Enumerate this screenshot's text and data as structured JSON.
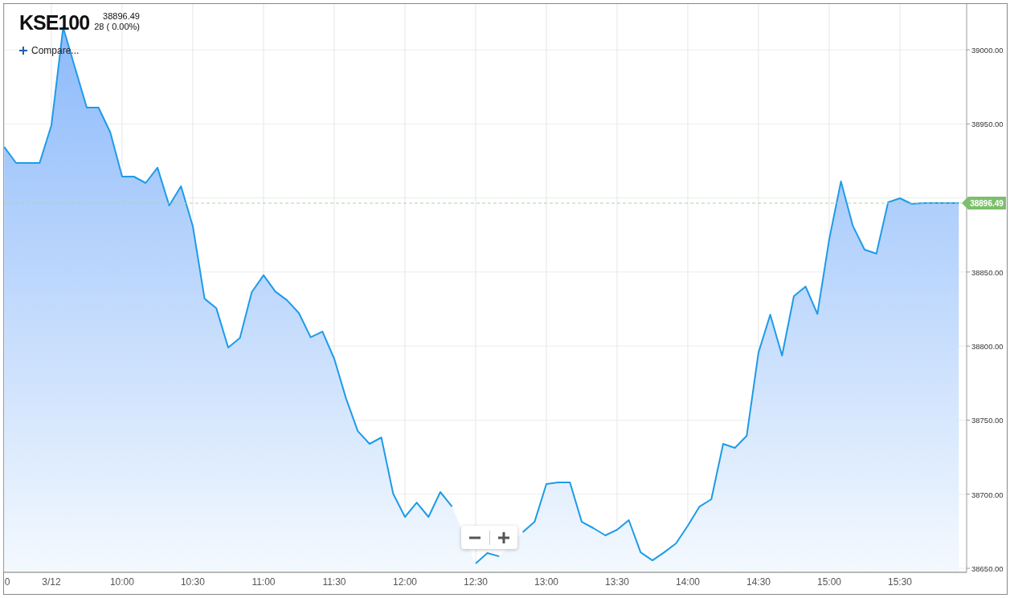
{
  "header": {
    "symbol": "KSE100",
    "price": "38896.49",
    "change": "28 ( 0.00%)",
    "compare_button": "Compare..."
  },
  "price_tag": "38896.49",
  "chart_data": {
    "type": "area",
    "grid": true,
    "ylim": [
      38647.3,
      39030.9
    ],
    "ref_lines": [
      {
        "axis": "y",
        "value": 38896.5,
        "color": "#a9d8a2"
      }
    ],
    "categories": [
      "0",
      null,
      null,
      null,
      "3/12",
      null,
      null,
      null,
      null,
      null,
      "10:00",
      null,
      null,
      null,
      null,
      null,
      "10:30",
      null,
      null,
      null,
      null,
      null,
      "11:00",
      null,
      null,
      null,
      null,
      null,
      "11:30",
      null,
      null,
      null,
      null,
      null,
      "12:00",
      null,
      null,
      null,
      null,
      null,
      "12:30",
      null,
      null,
      null,
      null,
      null,
      "13:00",
      null,
      null,
      null,
      null,
      null,
      "13:30",
      null,
      null,
      null,
      null,
      null,
      "14:00",
      null,
      null,
      null,
      null,
      null,
      "14:30",
      null,
      null,
      null,
      null,
      null,
      "15:00",
      null,
      null,
      null,
      null,
      null,
      "15:30",
      null,
      null,
      null,
      null,
      null
    ],
    "yticks": [
      {
        "value": 38650,
        "label": "38650.00"
      },
      {
        "value": 38700,
        "label": "38700.00"
      },
      {
        "value": 38750,
        "label": "38750.00"
      },
      {
        "value": 38800,
        "label": "38800.00"
      },
      {
        "value": 38850,
        "label": "38850.00"
      },
      {
        "value": 38950,
        "label": "38950.00"
      },
      {
        "value": 39000,
        "label": "39000.00"
      }
    ],
    "series": [
      {
        "color": "#1e9be8",
        "values": [
          38934.4,
          38923.6,
          38923.6,
          38923.6,
          38949.1,
          39015.0,
          38988.0,
          38961.0,
          38961.0,
          38944.2,
          38914.4,
          38914.4,
          38910.1,
          38920.4,
          38894.9,
          38907.9,
          38880.8,
          38832.0,
          38825.5,
          38799.0,
          38805.5,
          38836.4,
          38847.8,
          38836.9,
          38830.9,
          38822.3,
          38806.0,
          38809.8,
          38791.4,
          38764.8,
          38742.6,
          38734.0,
          38738.3,
          38700.4,
          38684.7,
          38694.4,
          38684.7,
          38701.5,
          38691.7,
          null,
          38653.3,
          38660.3,
          38658.1,
          null,
          38674.4,
          38681.4,
          38706.9,
          38708.0,
          38708.0,
          38681.4,
          38677.1,
          38672.2,
          38676.0,
          38682.5,
          38660.8,
          38655.4,
          38660.8,
          38666.8,
          38678.7,
          38691.7,
          38696.6,
          38734.0,
          38731.3,
          38739.4,
          38795.7,
          38821.2,
          38793.6,
          38833.7,
          38840.2,
          38821.7,
          38872.1,
          38911.1,
          38881.3,
          38865.1,
          38862.4,
          38897.1,
          38899.8,
          38896.0,
          38896.5,
          38896.5,
          38896.5,
          38896.5
        ]
      }
    ]
  }
}
